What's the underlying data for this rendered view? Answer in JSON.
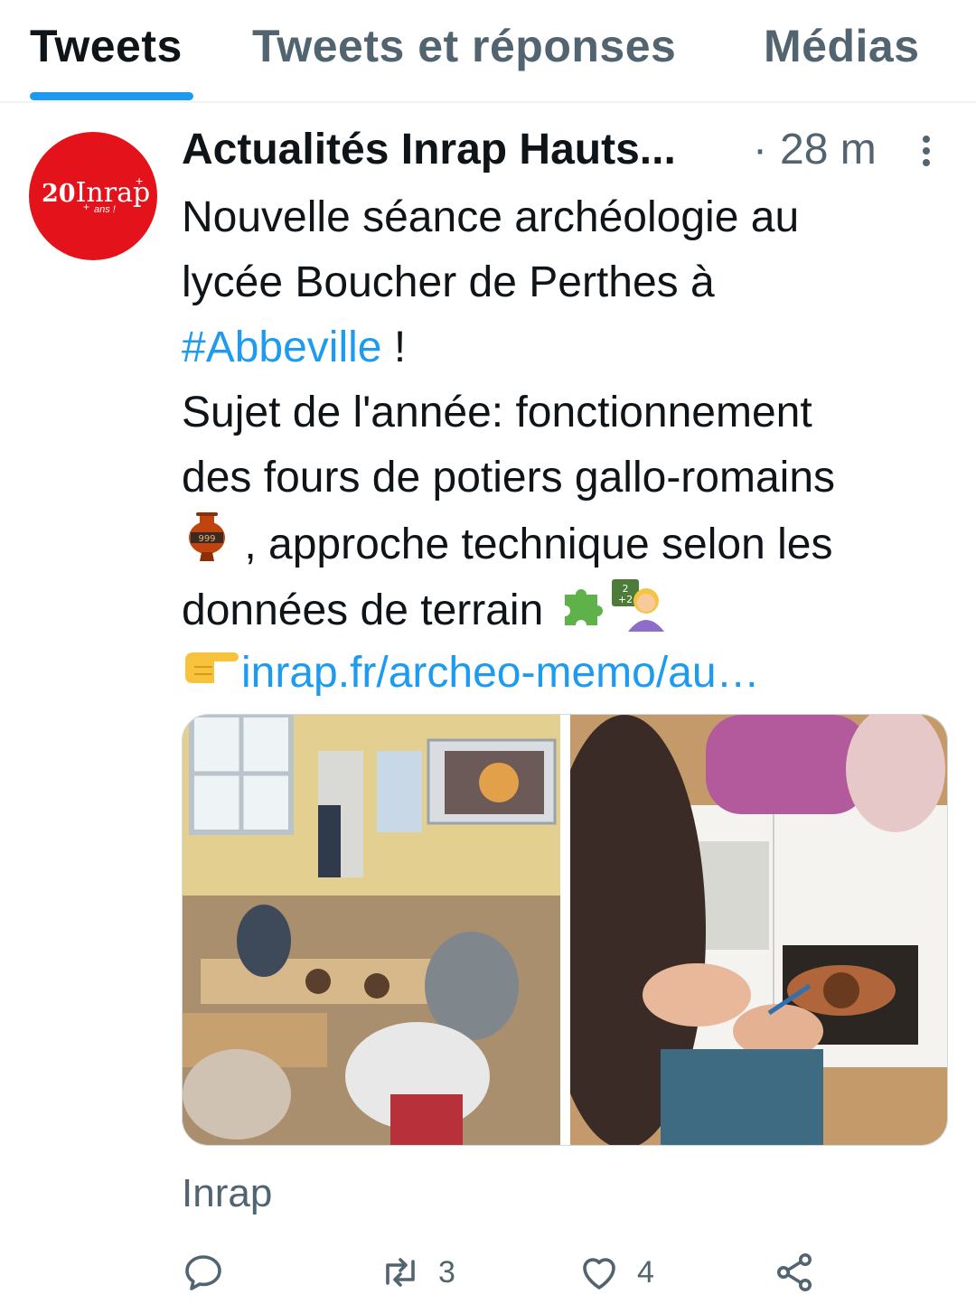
{
  "tabs": [
    {
      "label": "Tweets",
      "active": true
    },
    {
      "label": "Tweets et réponses",
      "active": false
    },
    {
      "label": "Médias",
      "active": false
    }
  ],
  "tweet": {
    "avatar": {
      "logo_number": "20",
      "logo_word": "Inrap",
      "logo_sub": "ans !",
      "color": "#e4121a"
    },
    "author": "Actualités Inrap Hauts...",
    "separator": "·",
    "time": "28 m",
    "body": {
      "line1": "Nouvelle séance archéologie au",
      "line2": "lycée Boucher de Perthes à",
      "hashtag": "#Abbeville",
      "hashtag_suffix": " !",
      "line4": "Sujet de l'année: fonctionnement",
      "line5": "des fours de potiers gallo-romains",
      "line6_after_emoji": " , approche technique selon les",
      "line7": "données de terrain ",
      "link": "inrap.fr/archeo-memo/au…"
    },
    "emojis": [
      "amphora-emoji",
      "puzzle-emoji",
      "teacher-emoji",
      "pointing-right-emoji"
    ],
    "source": "Inrap",
    "actions": {
      "reply_count": "",
      "retweet_count": "3",
      "like_count": "4"
    }
  },
  "colors": {
    "accent": "#1d9bf0",
    "muted": "#536471",
    "text": "#0f1419"
  }
}
